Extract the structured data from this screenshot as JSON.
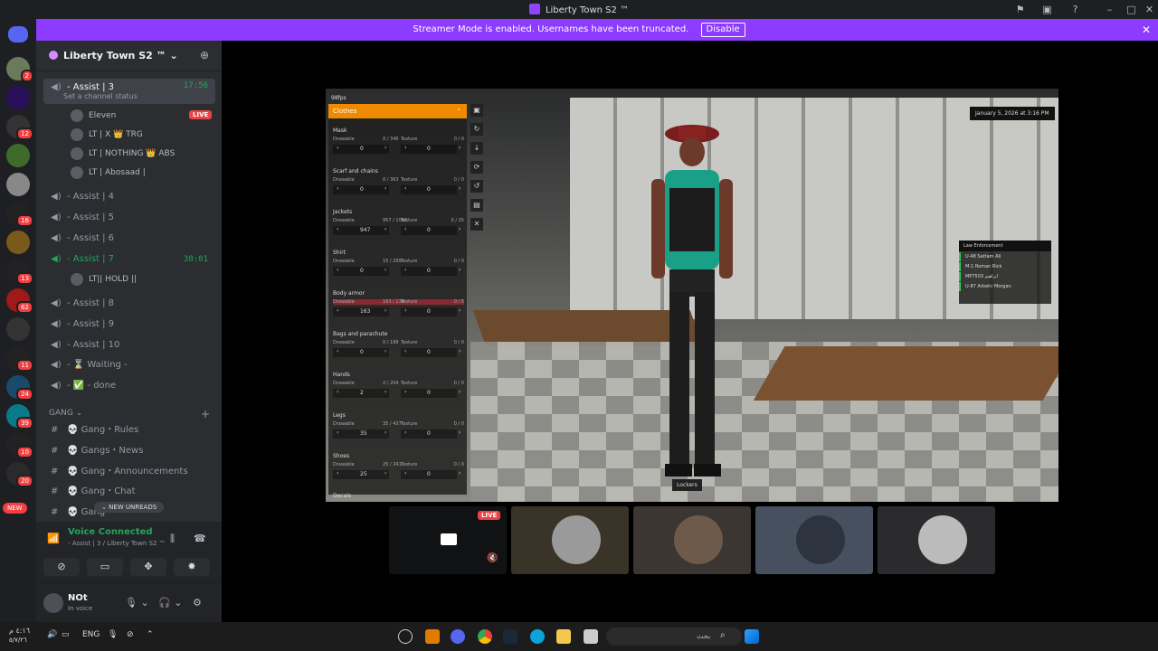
{
  "window": {
    "title": "Liberty Town S2 ™"
  },
  "streamer_bar": {
    "message": "Streamer Mode is enabled. Usernames have been truncated.",
    "disable_label": "Disable"
  },
  "rail": {
    "new_label": "NEW"
  },
  "server": {
    "name": "Liberty Town S2 ™"
  },
  "channels": {
    "assist3": {
      "name": "- Assist | 3",
      "time": "17:56",
      "status": "Set a channel status"
    },
    "assist3_users": [
      {
        "name": "Eleven",
        "live": "LIVE"
      },
      {
        "name": "LT | X 👑 TRG"
      },
      {
        "name": "LT | NOTHING 👑 ABS"
      },
      {
        "name": "LT | Abosaad |"
      }
    ],
    "assist4": "- Assist | 4",
    "assist5": "- Assist | 5",
    "assist6": "- Assist | 6",
    "assist7": {
      "name": "- Assist | 7",
      "time": "38:01"
    },
    "assist7_user": "LT|| HOLD ||",
    "assist8": "- Assist | 8",
    "assist9": "- Assist | 9",
    "assist10": "- Assist | 10",
    "waiting": "- ⌛ Waiting -",
    "done": "- ✅ - done"
  },
  "gang": {
    "category": "GANG",
    "items": [
      "Gang・Rules",
      "Gangs・News",
      "Gang・Announcements",
      "Gang・Chat",
      "Gang"
    ]
  },
  "new_unreads": "NEW UNREADS",
  "voice": {
    "title": "Voice Connected",
    "sub": "- Assist | 3 / Liberty Town S2 ™"
  },
  "userbar": {
    "name": "NOt",
    "status": "In voice"
  },
  "game": {
    "fps": "98fps",
    "date": "January 5, 2026 at 3:16 PM",
    "menu_title": "Clothes",
    "sections": [
      {
        "name": "Mask",
        "draw": "0 / 346",
        "tex": "0 / 0",
        "v1": "0",
        "v2": "0"
      },
      {
        "name": "Scarf and chains",
        "draw": "0 / 363",
        "tex": "0 / 0",
        "v1": "0",
        "v2": "0"
      },
      {
        "name": "Jackets",
        "draw": "957 / 1086",
        "tex": "0 / 25",
        "v1": "947",
        "v2": "0"
      },
      {
        "name": "Shirt",
        "draw": "15 / 299",
        "tex": "0 / 0",
        "v1": "0",
        "v2": "0"
      },
      {
        "name": "Body armor",
        "draw": "163 / 234",
        "tex": "0 / 5",
        "v1": "163",
        "v2": "0"
      },
      {
        "name": "Bags and parachute",
        "draw": "0 / 188",
        "tex": "0 / 0",
        "v1": "0",
        "v2": "0"
      },
      {
        "name": "Hands",
        "draw": "2 / 204",
        "tex": "0 / 0",
        "v1": "2",
        "v2": "0"
      },
      {
        "name": "Legs",
        "draw": "35 / 437",
        "tex": "0 / 0",
        "v1": "35",
        "v2": "0"
      },
      {
        "name": "Shoes",
        "draw": "25 / 241",
        "tex": "0 / 0",
        "v1": "25",
        "v2": "0"
      }
    ],
    "drawable_label": "Drawable",
    "texture_label": "Texture",
    "decals": "Decals",
    "lockers_label": "Lockers",
    "pd_title": "Law Enforcement",
    "pd_rows": [
      "Sattam Ali",
      "Roman Rick",
      "ابراهيم",
      "Arbehr Morgan"
    ],
    "pd_codes": [
      "U-48",
      "M-1",
      "MP7503",
      "U-87"
    ]
  },
  "stream_live": "LIVE",
  "taskbar": {
    "lang": "ENG",
    "time": "٤:١٦ م",
    "date": "٥/٧/٢٦",
    "search": "بحث"
  },
  "colors": {
    "accent": "#8c3bff",
    "green": "#23a55a",
    "red": "#f23f42",
    "orange": "#f08a00"
  }
}
